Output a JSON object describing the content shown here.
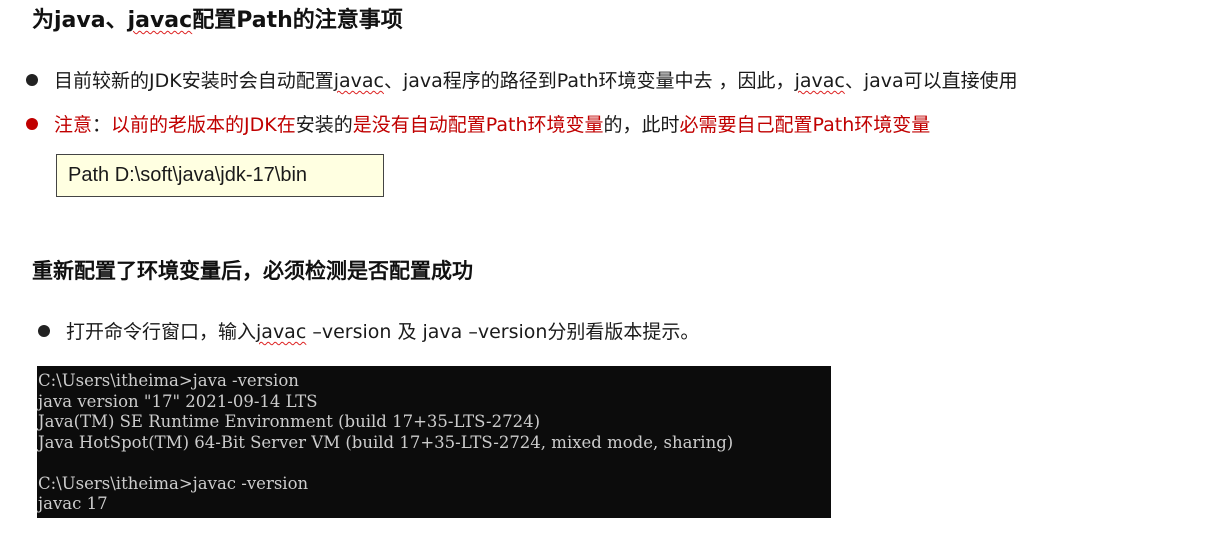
{
  "title": {
    "prefix": "为java、",
    "squiggle": "javac",
    "suffix": "配置Path的注意事项"
  },
  "bullet1": {
    "text_a": "目前较新的JDK安装时会自动配置",
    "squiggle_a": "javac",
    "text_b": "、java程序的路径到Path环境变量中去 ，因此，",
    "squiggle_b": "javac",
    "text_c": "、java可以直接使用"
  },
  "bullet2": {
    "red_a": "注意",
    "black_a": "：",
    "red_b": "以前的老版本的JDK在",
    "black_b": "安装的",
    "red_c": "是没有自动配置Path环境变量",
    "black_c": "的，此时",
    "red_d": "必需要自己配置Path环境变量"
  },
  "path_box": {
    "text": "Path  D:\\soft\\java\\jdk-17\\bin"
  },
  "heading2": "重新配置了环境变量后，必须检测是否配置成功",
  "bullet3": {
    "text_a": "打开命令行窗口，输入",
    "squiggle": "javac",
    "text_b": " –version 及 java –version分别看版本提示。"
  },
  "terminal": {
    "lines": [
      "C:\\Users\\itheima>java -version",
      "java version \"17\" 2021-09-14 LTS",
      "Java(TM) SE Runtime Environment (build 17+35-LTS-2724)",
      "Java HotSpot(TM) 64-Bit Server VM (build 17+35-LTS-2724, mixed mode, sharing)",
      "",
      "C:\\Users\\itheima>javac -version",
      "javac 17"
    ]
  },
  "colors": {
    "accent_red": "#c00000",
    "path_box_bg": "#ffffe1",
    "terminal_bg": "#0c0c0c",
    "terminal_text": "#cccccc"
  }
}
